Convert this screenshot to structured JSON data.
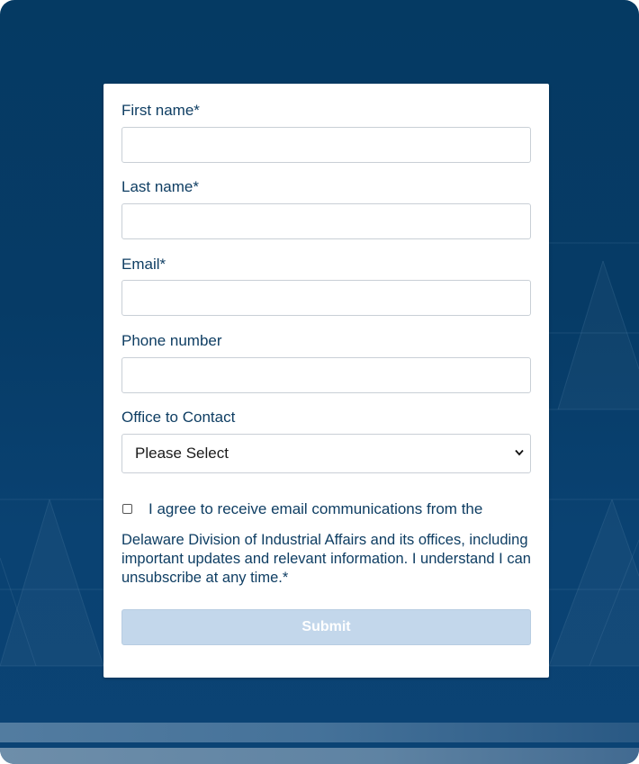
{
  "colors": {
    "background": "#063b66",
    "card": "#ffffff",
    "label_text": "#0f3e63",
    "submit_disabled": "#c3d7eb"
  },
  "form": {
    "first_name": {
      "label": "First name*",
      "value": ""
    },
    "last_name": {
      "label": "Last name*",
      "value": ""
    },
    "email": {
      "label": "Email*",
      "value": ""
    },
    "phone": {
      "label": "Phone number",
      "value": ""
    },
    "office": {
      "label": "Office to Contact",
      "selected": "Please Select"
    },
    "consent": {
      "checked": false,
      "line1": "I agree to receive email communications from the",
      "rest": "Delaware Division of Industrial Affairs and its offices, including important updates and relevant information. I understand I can unsubscribe at any time.*"
    },
    "submit_label": "Submit"
  }
}
